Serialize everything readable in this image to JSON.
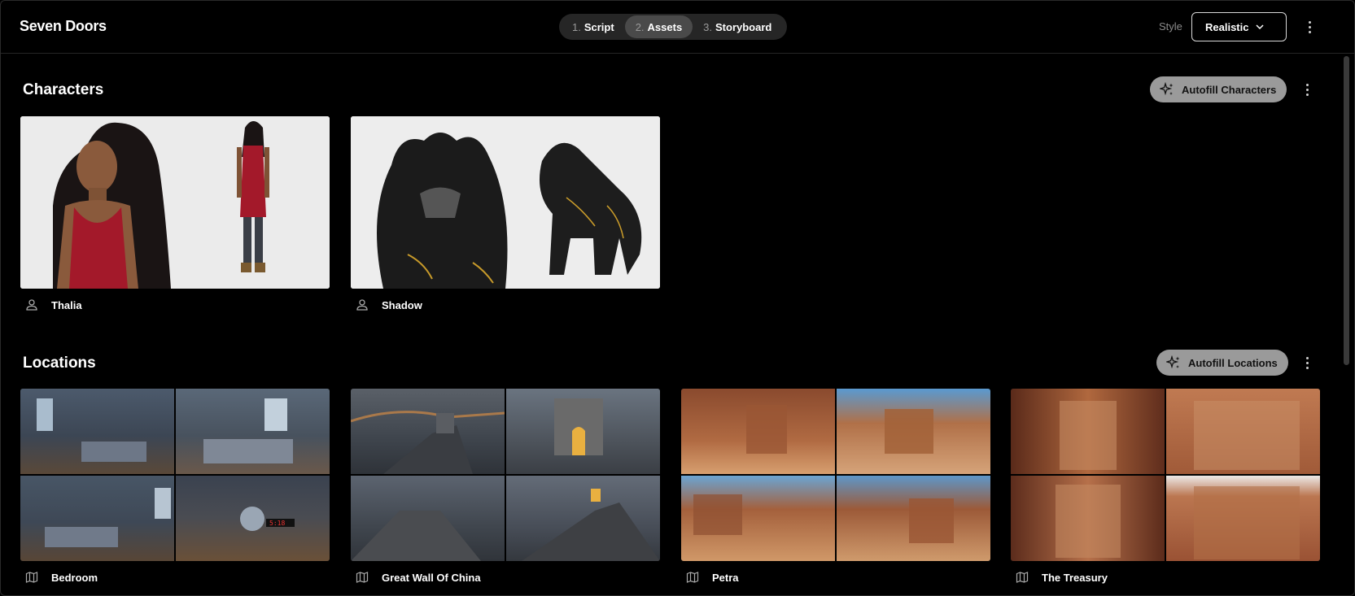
{
  "app": {
    "title": "Seven Doors"
  },
  "steps": [
    {
      "num": "1.",
      "label": "Script",
      "active": false
    },
    {
      "num": "2.",
      "label": "Assets",
      "active": true
    },
    {
      "num": "3.",
      "label": "Storyboard",
      "active": false
    }
  ],
  "style": {
    "label": "Style",
    "value": "Realistic"
  },
  "characters": {
    "title": "Characters",
    "autofill_label": "Autofill Characters",
    "items": [
      {
        "name": "Thalia",
        "icon": "person-icon"
      },
      {
        "name": "Shadow",
        "icon": "person-icon"
      }
    ]
  },
  "locations": {
    "title": "Locations",
    "autofill_label": "Autofill Locations",
    "items": [
      {
        "name": "Bedroom",
        "icon": "map-icon"
      },
      {
        "name": "Great Wall Of China",
        "icon": "map-icon"
      },
      {
        "name": "Petra",
        "icon": "map-icon"
      },
      {
        "name": "The Treasury",
        "icon": "map-icon"
      }
    ]
  },
  "colors": {
    "background": "#000000",
    "pill_bg": "#262626",
    "pill_active": "#4a4a4a",
    "autofill_bg": "#9a9a9a"
  }
}
